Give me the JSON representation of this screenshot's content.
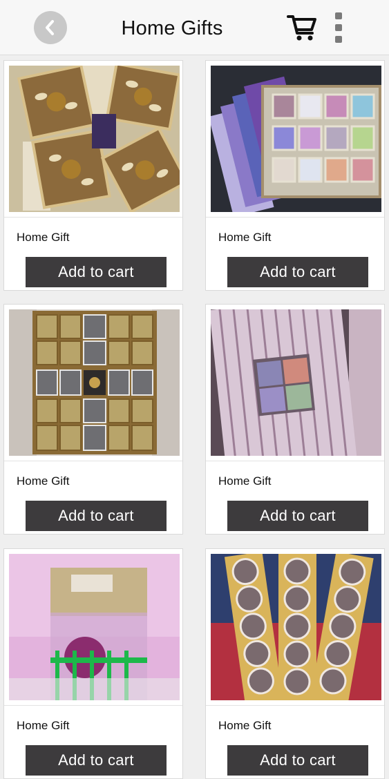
{
  "header": {
    "title": "Home Gifts",
    "back_icon": "chevron-left-icon",
    "cart_icon": "shopping-cart-icon",
    "menu_icon": "more-vertical-icon"
  },
  "products": [
    {
      "name": "Home Gift",
      "button": "Add to cart",
      "image": "gift-box-ornate-square"
    },
    {
      "name": "Home Gift",
      "button": "Add to cart",
      "image": "colorful-chocolate-box"
    },
    {
      "name": "Home Gift",
      "button": "Add to cart",
      "image": "gold-chocolate-tray"
    },
    {
      "name": "Home Gift",
      "button": "Add to cart",
      "image": "striped-gift-box"
    },
    {
      "name": "Home Gift",
      "button": "Add to cart",
      "image": "wrapped-gift-basket"
    },
    {
      "name": "Home Gift",
      "button": "Add to cart",
      "image": "heart-chocolate-tray"
    }
  ],
  "colors": {
    "button_bg": "#3d3b3d",
    "button_text": "#ffffff",
    "page_bg": "#efefef",
    "header_bg": "#f7f7f7"
  }
}
